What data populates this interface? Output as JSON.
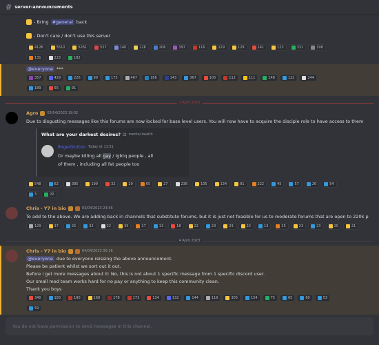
{
  "channel": {
    "name": "server-announcements"
  },
  "top_block": {
    "line1_prefix": "- Bring",
    "line1_mention": "#general",
    "line1_suffix": "back",
    "line2_text": "- Don't care / don't use this server",
    "reactions1": [
      "4126",
      "5510",
      "5261",
      "527",
      "140",
      "128",
      "206",
      "397",
      "116",
      "129",
      "129",
      "141",
      "123",
      "331",
      "198"
    ],
    "reactions2": [
      "131",
      "223",
      "182"
    ],
    "mention_line": "@everyone",
    "mention_suffix": "***",
    "reactions3": [
      "357",
      "429",
      "226",
      "99",
      "173",
      "467",
      "186",
      "143",
      "367",
      "105",
      "112",
      "111",
      "148",
      "122",
      "244"
    ],
    "reactions4": [
      "189",
      "55",
      "91"
    ]
  },
  "divider1": {
    "label": "3 April 2023"
  },
  "msg1": {
    "author": "Agro",
    "timestamp": "03/04/2023 19:02",
    "text": "Due to disgusting messages like this forums are now locked for base level users. You will now have to acquire the disciple role to have access to them",
    "forward": {
      "title": "What are your darkest desires?",
      "channel": "mental-health",
      "inner_author": "RogerGlutton",
      "inner_time": "Today at 11:51",
      "line1_pre": "Or maybe killing all",
      "line1_hl": "gay",
      "line1_post": "/ lgbtq people , all",
      "line2": "of them , including all fat people too"
    },
    "reactions1": [
      "548",
      "62",
      "385",
      "199",
      "32",
      "29",
      "65",
      "27",
      "236",
      "105",
      "134",
      "91",
      "222",
      "45",
      "57",
      "26",
      "54"
    ],
    "reactions2": [
      "3",
      "20"
    ]
  },
  "msg2": {
    "author": "Chris - Y7 in bio",
    "timestamp": "03/04/2023 23:56",
    "text": "To add to the above. We are adding back in channels that substitute forums, but it is just not feasible for us to moderate forums that are open to 220k p",
    "reactions1": [
      "129",
      "37",
      "25",
      "32",
      "22",
      "35",
      "27",
      "13",
      "18",
      "22",
      "23",
      "23",
      "22",
      "13",
      "25",
      "23",
      "23",
      "25",
      "21"
    ]
  },
  "divider2": {
    "label": "4 April 2023"
  },
  "msg3": {
    "author": "Chris - Y7 in bio",
    "timestamp": "04/04/2023 00:16",
    "mention": "@everyone",
    "line1_rest": "due to everyone reissing the above announcement.",
    "line2": "Please be patient whilst we sort out it out.",
    "line3": "Before i get more messages about it: No, this is not about 1 specific message from 1 specific discord user.",
    "line4": "Our small mod team works hard for no pay or anything to keep this community clean.",
    "line5": "Thank you boys",
    "reactions1": [
      "340",
      "183",
      "190",
      "168",
      "178",
      "173",
      "134",
      "132",
      "144",
      "119",
      "305",
      "154",
      "75",
      "65",
      "60",
      "53"
    ],
    "reactions2": [
      "59"
    ]
  },
  "input": {
    "placeholder": "You do not have permission to send messages in this channel."
  },
  "colors": {
    "accent": "#5865f2",
    "mention_bg": "#3c4270",
    "gold_bar": "#f0b232",
    "red_divider": "#f23f43",
    "chris_name": "#e0a85c",
    "agro_name": "#e0a85c"
  }
}
